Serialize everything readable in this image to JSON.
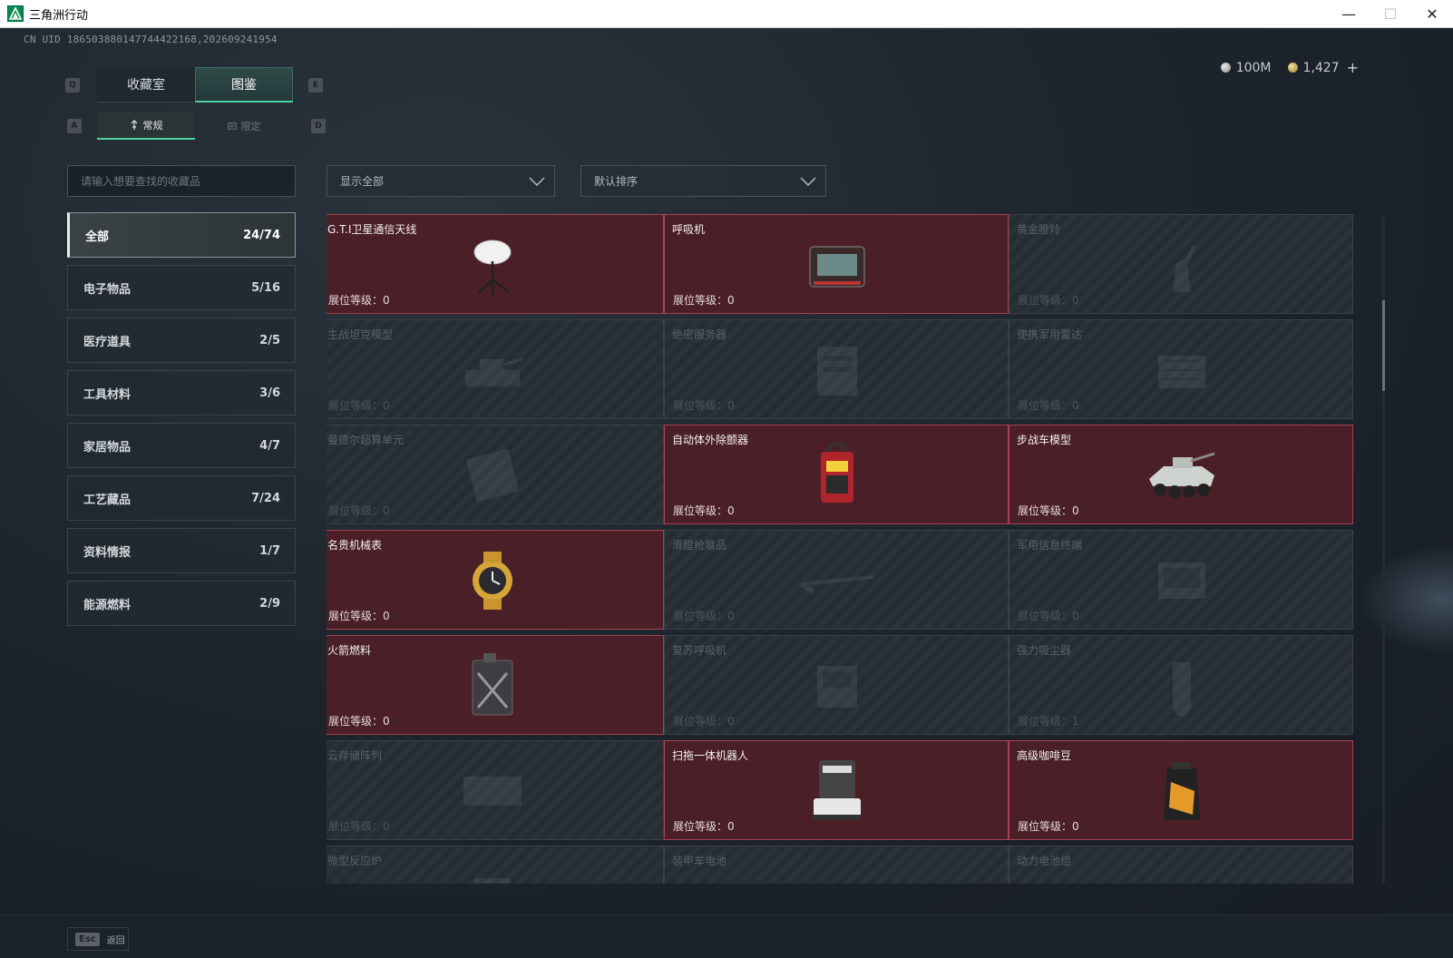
{
  "window": {
    "title": "三角洲行动",
    "minimize": "—",
    "maximize": "☐",
    "close": "✕"
  },
  "uid": "CN UID 1865038801477444221​68,202609241954",
  "currency": {
    "silver": "100M",
    "gold": "1,427",
    "add": "+"
  },
  "keys": {
    "q": "Q",
    "e": "E",
    "a": "A",
    "d": "D"
  },
  "tabs": [
    {
      "label": "收藏室"
    },
    {
      "label": "图鉴"
    }
  ],
  "subtabs": [
    {
      "label": "常规"
    },
    {
      "label": "限定"
    }
  ],
  "search": {
    "placeholder": "请输入想要查找的收藏品"
  },
  "categories": [
    {
      "label": "全部",
      "count": "24/74"
    },
    {
      "label": "电子物品",
      "count": "5/16"
    },
    {
      "label": "医疗道具",
      "count": "2/5"
    },
    {
      "label": "工具材料",
      "count": "3/6"
    },
    {
      "label": "家居物品",
      "count": "4/7"
    },
    {
      "label": "工艺藏品",
      "count": "7/24"
    },
    {
      "label": "资料情报",
      "count": "1/7"
    },
    {
      "label": "能源燃料",
      "count": "2/9"
    }
  ],
  "filter": {
    "display": "显示全部",
    "sort": "默认排序"
  },
  "level_prefix": "展位等级：",
  "items": [
    {
      "name": "G.T.I卫星通信天线",
      "level": "0",
      "owned": true,
      "icon": "satellite-dish-icon"
    },
    {
      "name": "呼吸机",
      "level": "0",
      "owned": true,
      "icon": "ventilator-icon"
    },
    {
      "name": "黄金瞪羚",
      "level": "0",
      "owned": false,
      "icon": "gazelle-statue-icon"
    },
    {
      "name": "主战坦克模型",
      "level": "0",
      "owned": false,
      "icon": "tank-model-icon"
    },
    {
      "name": "绝密服务器",
      "level": "0",
      "owned": false,
      "icon": "server-icon"
    },
    {
      "name": "便携军用雷达",
      "level": "0",
      "owned": false,
      "icon": "radar-icon"
    },
    {
      "name": "曼德尔超算单元",
      "level": "0",
      "owned": false,
      "icon": "compute-unit-icon"
    },
    {
      "name": "自动体外除颤器",
      "level": "0",
      "owned": true,
      "icon": "defibrillator-icon"
    },
    {
      "name": "步战车模型",
      "level": "0",
      "owned": true,
      "icon": "ifv-model-icon"
    },
    {
      "name": "名贵机械表",
      "level": "0",
      "owned": true,
      "icon": "watch-icon"
    },
    {
      "name": "滑膛枪展品",
      "level": "0",
      "owned": false,
      "icon": "musket-icon"
    },
    {
      "name": "军用信息终端",
      "level": "0",
      "owned": false,
      "icon": "terminal-icon"
    },
    {
      "name": "火箭燃料",
      "level": "0",
      "owned": true,
      "icon": "fuel-can-icon"
    },
    {
      "name": "复苏呼吸机",
      "level": "0",
      "owned": false,
      "icon": "resuscitator-icon"
    },
    {
      "name": "强力吸尘器",
      "level": "1",
      "owned": false,
      "icon": "vacuum-icon"
    },
    {
      "name": "云存储阵列",
      "level": "0",
      "owned": false,
      "icon": "storage-array-icon"
    },
    {
      "name": "扫拖一体机器人",
      "level": "0",
      "owned": true,
      "icon": "robot-mop-icon"
    },
    {
      "name": "高级咖啡豆",
      "level": "0",
      "owned": true,
      "icon": "coffee-bag-icon"
    },
    {
      "name": "微型反应炉",
      "level": "",
      "owned": false,
      "icon": "reactor-icon"
    },
    {
      "name": "装甲车电池",
      "level": "",
      "owned": false,
      "icon": "battery-icon"
    },
    {
      "name": "动力电池组",
      "level": "",
      "owned": false,
      "icon": "battery-pack-icon"
    }
  ],
  "footer": {
    "esc_key": "Esc",
    "esc_label": "返回"
  },
  "colors": {
    "owned_bg": "#4b1f27",
    "owned_border": "#a74152",
    "accent": "#4ed49c"
  }
}
